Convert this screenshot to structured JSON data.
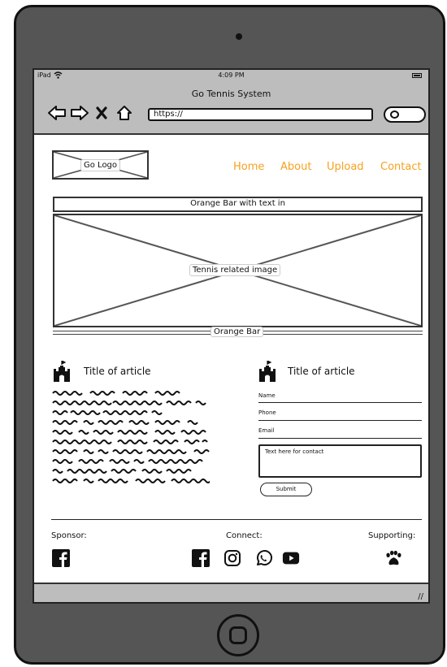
{
  "status_bar": {
    "carrier": "iPad",
    "time": "4:09 PM"
  },
  "browser": {
    "title": "Go Tennis System",
    "url": "https://"
  },
  "site": {
    "logo_label": "Go Logo",
    "nav": [
      "Home",
      "About",
      "Upload",
      "Contact"
    ],
    "orange_bar_label": "Orange Bar with text in",
    "hero_label": "Tennis related image",
    "bottom_bar_label": "Orange Bar",
    "accent_color": "#f6a21e"
  },
  "articles": [
    {
      "title": "Title of article",
      "icon": "castle-icon"
    },
    {
      "title": "Title of article",
      "icon": "castle-icon"
    }
  ],
  "contact_form": {
    "name_label": "Name",
    "phone_label": "Phone",
    "email_label": "Email",
    "message_placeholder": "Text here for contact",
    "submit_label": "Submit"
  },
  "footer": {
    "sponsor_label": "Sponsor:",
    "connect_label": "Connect:",
    "supporting_label": "Supporting:",
    "sponsor_icons": [
      "facebook-icon"
    ],
    "connect_icons": [
      "facebook-icon",
      "instagram-icon",
      "whatsapp-icon",
      "youtube-icon"
    ],
    "supporting_icons": [
      "paw-icon"
    ]
  }
}
